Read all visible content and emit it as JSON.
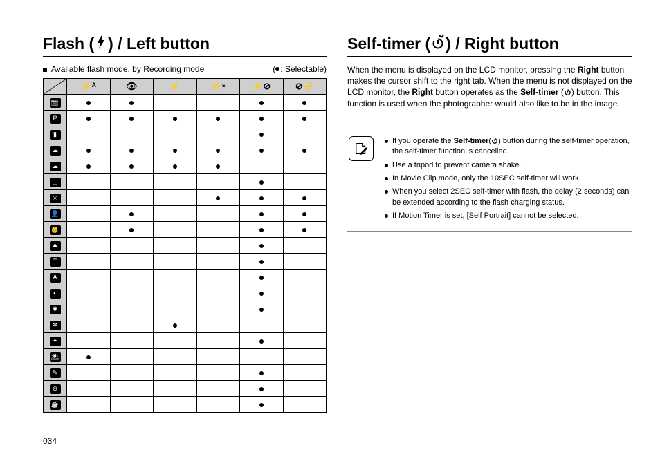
{
  "left": {
    "title_a": "Flash (",
    "title_b": ") / Left button",
    "intro": "Available flash mode, by Recording mode",
    "legend_a": "(",
    "legend_b": ": Selectable)",
    "columns": [
      "flash-auto",
      "eye",
      "flash",
      "flash-s",
      "globe-flash",
      "no-flash"
    ],
    "rows": [
      {
        "icon": "camera",
        "cells": [
          1,
          1,
          0,
          0,
          1,
          1
        ]
      },
      {
        "icon": "camera-p",
        "cells": [
          1,
          1,
          1,
          1,
          1,
          1
        ]
      },
      {
        "icon": "portrait",
        "cells": [
          0,
          0,
          0,
          0,
          1,
          0
        ]
      },
      {
        "icon": "cloud",
        "cells": [
          1,
          1,
          1,
          1,
          1,
          1
        ]
      },
      {
        "icon": "cloud-2",
        "cells": [
          1,
          1,
          1,
          1,
          0,
          0
        ]
      },
      {
        "icon": "frame",
        "cells": [
          0,
          0,
          0,
          0,
          1,
          0
        ]
      },
      {
        "icon": "target",
        "cells": [
          0,
          0,
          0,
          1,
          1,
          1
        ]
      },
      {
        "icon": "person",
        "cells": [
          0,
          1,
          0,
          0,
          1,
          1
        ]
      },
      {
        "icon": "child",
        "cells": [
          0,
          1,
          0,
          0,
          1,
          1
        ]
      },
      {
        "icon": "landscape",
        "cells": [
          0,
          0,
          0,
          0,
          1,
          0
        ]
      },
      {
        "icon": "text",
        "cells": [
          0,
          0,
          0,
          0,
          1,
          0
        ]
      },
      {
        "icon": "flower",
        "cells": [
          0,
          0,
          0,
          0,
          1,
          0
        ]
      },
      {
        "icon": "sunset",
        "cells": [
          0,
          0,
          0,
          0,
          1,
          0
        ]
      },
      {
        "icon": "dawn",
        "cells": [
          0,
          0,
          0,
          0,
          1,
          0
        ]
      },
      {
        "icon": "backlight",
        "cells": [
          0,
          0,
          1,
          0,
          0,
          0
        ]
      },
      {
        "icon": "firework",
        "cells": [
          0,
          0,
          0,
          0,
          1,
          0
        ]
      },
      {
        "icon": "beach",
        "cells": [
          1,
          0,
          0,
          0,
          0,
          0
        ]
      },
      {
        "icon": "self",
        "cells": [
          0,
          0,
          0,
          0,
          1,
          0
        ]
      },
      {
        "icon": "food",
        "cells": [
          0,
          0,
          0,
          0,
          1,
          0
        ]
      },
      {
        "icon": "cafe",
        "cells": [
          0,
          0,
          0,
          0,
          1,
          0
        ]
      }
    ]
  },
  "right": {
    "title_a": "Self-timer (",
    "title_b": ") / Right button",
    "p1a": "When the menu is displayed on the LCD monitor, pressing the ",
    "p1b": "Right",
    "p1c": " button makes the cursor shift to the right tab. When the menu is not displayed on the LCD monitor, the ",
    "p1d": "Right",
    "p1e": " button operates as the ",
    "p1f": "Self-timer",
    "p1g": " (",
    "p1h": ") button. This function is used when the photographer would also like to be in the image.",
    "notes": [
      {
        "pre": "If you operate the ",
        "bold": "Self-timer",
        "mid": "(",
        "post": ") button during the self-timer operation, the self-timer function is cancelled.",
        "icon": true
      },
      {
        "text": "Use a tripod to prevent camera shake."
      },
      {
        "text": "In Movie Clip mode, only the 10SEC self-timer will work."
      },
      {
        "text": "When you select 2SEC self-timer with flash, the delay (2 seconds) can be extended according to the flash charging status."
      },
      {
        "text": "If Motion Timer is set, [Self Portrait] cannot be selected."
      }
    ]
  },
  "page_number": "034",
  "icon_glyphs": {
    "camera": "📷",
    "camera-p": "P",
    "portrait": "▮",
    "cloud": "☁",
    "cloud-2": "☁",
    "frame": "▢",
    "target": "◎",
    "person": "👤",
    "child": "👶",
    "landscape": "⛰",
    "text": "T",
    "flower": "❀",
    "sunset": "◐",
    "dawn": "✺",
    "backlight": "✲",
    "firework": "✦",
    "beach": "⛱",
    "self": "✎",
    "food": "⊕",
    "cafe": "☕"
  },
  "col_glyphs": {
    "flash-auto": "⚡ᴬ",
    "eye": "👁",
    "flash": "⚡",
    "flash-s": "⚡ˢ",
    "globe-flash": "⚡⊘",
    "no-flash": "⊘⚡"
  }
}
